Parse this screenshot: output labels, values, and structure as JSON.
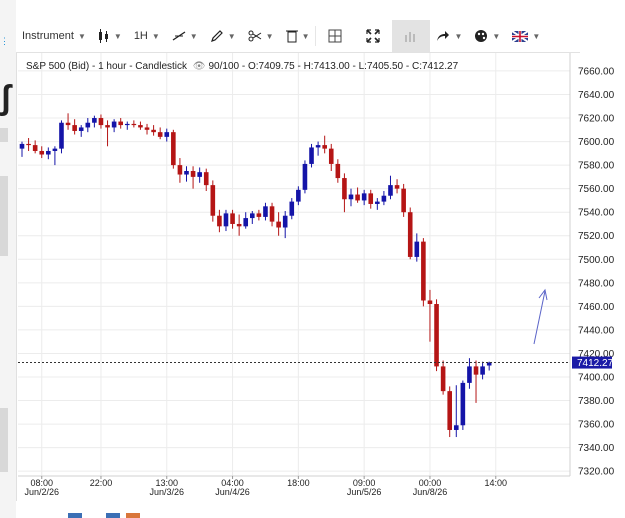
{
  "toolbar": {
    "instrument_label": "Instrument",
    "timeframe_label": "1H",
    "buttons": [
      "candlestick-icon",
      "line-tool-icon",
      "pencil-icon",
      "scissors-icon",
      "trash-icon",
      "crosshair-icon",
      "expand-icon",
      "indicator-icon",
      "share-icon",
      "palette-icon",
      "language-flag-icon"
    ]
  },
  "header": {
    "symbol": "S&P 500 (Bid) - 1 hour - Candlestick",
    "visibility": "90/100 -",
    "ohlc": "O:7409.75 - H:7413.00 - L:7405.50 - C:7412.27"
  },
  "colors": {
    "up": "#1414a8",
    "down": "#b51515",
    "price_line": "#333333",
    "price_tag_bg": "#1a1aa6",
    "annotation": "#5b64c8"
  },
  "chart_data": {
    "type": "candlestick",
    "title": "S&P 500 (Bid) - 1 hour - Candlestick",
    "current_price_label": "7412.27",
    "ylim": [
      7310,
      7670
    ],
    "y_ticks": [
      "7660.00",
      "7640.00",
      "7620.00",
      "7600.00",
      "7580.00",
      "7560.00",
      "7540.00",
      "7520.00",
      "7500.00",
      "7480.00",
      "7460.00",
      "7440.00",
      "7420.00",
      "7400.00",
      "7380.00",
      "7360.00",
      "7340.00",
      "7320.00"
    ],
    "time_ticks": [
      {
        "i": 3,
        "label": "08:00",
        "date": "Jun/2/26"
      },
      {
        "i": 12,
        "label": "22:00",
        "date": ""
      },
      {
        "i": 22,
        "label": "13:00",
        "date": "Jun/3/26"
      },
      {
        "i": 32,
        "label": "04:00",
        "date": "Jun/4/26"
      },
      {
        "i": 42,
        "label": "18:00",
        "date": ""
      },
      {
        "i": 52,
        "label": "09:00",
        "date": "Jun/5/26"
      },
      {
        "i": 62,
        "label": "00:00",
        "date": "Jun/8/26"
      },
      {
        "i": 72,
        "label": "14:00",
        "date": ""
      }
    ],
    "candles": [
      {
        "o": 7594,
        "h": 7600,
        "l": 7587,
        "c": 7598
      },
      {
        "o": 7598,
        "h": 7603,
        "l": 7592,
        "c": 7597
      },
      {
        "o": 7597,
        "h": 7601,
        "l": 7590,
        "c": 7592
      },
      {
        "o": 7592,
        "h": 7596,
        "l": 7586,
        "c": 7589
      },
      {
        "o": 7589,
        "h": 7595,
        "l": 7585,
        "c": 7592
      },
      {
        "o": 7592,
        "h": 7596,
        "l": 7580,
        "c": 7594
      },
      {
        "o": 7594,
        "h": 7618,
        "l": 7590,
        "c": 7616
      },
      {
        "o": 7616,
        "h": 7624,
        "l": 7610,
        "c": 7614
      },
      {
        "o": 7614,
        "h": 7619,
        "l": 7606,
        "c": 7609
      },
      {
        "o": 7609,
        "h": 7614,
        "l": 7604,
        "c": 7612
      },
      {
        "o": 7612,
        "h": 7620,
        "l": 7608,
        "c": 7616
      },
      {
        "o": 7616,
        "h": 7622,
        "l": 7612,
        "c": 7620
      },
      {
        "o": 7620,
        "h": 7623,
        "l": 7611,
        "c": 7614
      },
      {
        "o": 7614,
        "h": 7618,
        "l": 7596,
        "c": 7612
      },
      {
        "o": 7612,
        "h": 7619,
        "l": 7608,
        "c": 7617
      },
      {
        "o": 7617,
        "h": 7620,
        "l": 7611,
        "c": 7614
      },
      {
        "o": 7614,
        "h": 7617,
        "l": 7610,
        "c": 7615
      },
      {
        "o": 7615,
        "h": 7618,
        "l": 7612,
        "c": 7614
      },
      {
        "o": 7614,
        "h": 7617,
        "l": 7610,
        "c": 7612
      },
      {
        "o": 7612,
        "h": 7615,
        "l": 7606,
        "c": 7610
      },
      {
        "o": 7610,
        "h": 7614,
        "l": 7605,
        "c": 7608
      },
      {
        "o": 7608,
        "h": 7612,
        "l": 7602,
        "c": 7604
      },
      {
        "o": 7604,
        "h": 7611,
        "l": 7600,
        "c": 7608
      },
      {
        "o": 7608,
        "h": 7610,
        "l": 7577,
        "c": 7580
      },
      {
        "o": 7580,
        "h": 7586,
        "l": 7565,
        "c": 7572
      },
      {
        "o": 7572,
        "h": 7579,
        "l": 7566,
        "c": 7575
      },
      {
        "o": 7575,
        "h": 7579,
        "l": 7560,
        "c": 7570
      },
      {
        "o": 7570,
        "h": 7578,
        "l": 7565,
        "c": 7574
      },
      {
        "o": 7574,
        "h": 7577,
        "l": 7558,
        "c": 7563
      },
      {
        "o": 7563,
        "h": 7567,
        "l": 7532,
        "c": 7537
      },
      {
        "o": 7537,
        "h": 7542,
        "l": 7523,
        "c": 7528
      },
      {
        "o": 7528,
        "h": 7542,
        "l": 7524,
        "c": 7539
      },
      {
        "o": 7539,
        "h": 7542,
        "l": 7526,
        "c": 7530
      },
      {
        "o": 7530,
        "h": 7538,
        "l": 7520,
        "c": 7528
      },
      {
        "o": 7528,
        "h": 7540,
        "l": 7526,
        "c": 7535
      },
      {
        "o": 7535,
        "h": 7541,
        "l": 7530,
        "c": 7539
      },
      {
        "o": 7539,
        "h": 7542,
        "l": 7533,
        "c": 7536
      },
      {
        "o": 7536,
        "h": 7548,
        "l": 7533,
        "c": 7545
      },
      {
        "o": 7545,
        "h": 7548,
        "l": 7528,
        "c": 7532
      },
      {
        "o": 7532,
        "h": 7540,
        "l": 7520,
        "c": 7527
      },
      {
        "o": 7527,
        "h": 7541,
        "l": 7518,
        "c": 7537
      },
      {
        "o": 7537,
        "h": 7552,
        "l": 7534,
        "c": 7549
      },
      {
        "o": 7549,
        "h": 7562,
        "l": 7546,
        "c": 7559
      },
      {
        "o": 7559,
        "h": 7584,
        "l": 7556,
        "c": 7581
      },
      {
        "o": 7581,
        "h": 7598,
        "l": 7578,
        "c": 7595
      },
      {
        "o": 7595,
        "h": 7600,
        "l": 7588,
        "c": 7597
      },
      {
        "o": 7597,
        "h": 7605,
        "l": 7590,
        "c": 7594
      },
      {
        "o": 7594,
        "h": 7598,
        "l": 7575,
        "c": 7581
      },
      {
        "o": 7581,
        "h": 7585,
        "l": 7565,
        "c": 7569
      },
      {
        "o": 7569,
        "h": 7573,
        "l": 7540,
        "c": 7551
      },
      {
        "o": 7551,
        "h": 7560,
        "l": 7545,
        "c": 7555
      },
      {
        "o": 7555,
        "h": 7561,
        "l": 7548,
        "c": 7550
      },
      {
        "o": 7550,
        "h": 7559,
        "l": 7546,
        "c": 7556
      },
      {
        "o": 7556,
        "h": 7559,
        "l": 7543,
        "c": 7547
      },
      {
        "o": 7547,
        "h": 7552,
        "l": 7542,
        "c": 7549
      },
      {
        "o": 7549,
        "h": 7558,
        "l": 7546,
        "c": 7554
      },
      {
        "o": 7554,
        "h": 7571,
        "l": 7551,
        "c": 7563
      },
      {
        "o": 7563,
        "h": 7568,
        "l": 7556,
        "c": 7560
      },
      {
        "o": 7560,
        "h": 7564,
        "l": 7536,
        "c": 7540
      },
      {
        "o": 7540,
        "h": 7544,
        "l": 7500,
        "c": 7502
      },
      {
        "o": 7502,
        "h": 7522,
        "l": 7498,
        "c": 7515
      },
      {
        "o": 7515,
        "h": 7518,
        "l": 7460,
        "c": 7465
      },
      {
        "o": 7465,
        "h": 7474,
        "l": 7430,
        "c": 7462
      },
      {
        "o": 7462,
        "h": 7466,
        "l": 7405,
        "c": 7409
      },
      {
        "o": 7409,
        "h": 7414,
        "l": 7385,
        "c": 7388
      },
      {
        "o": 7388,
        "h": 7392,
        "l": 7349,
        "c": 7355
      },
      {
        "o": 7355,
        "h": 7393,
        "l": 7349,
        "c": 7359
      },
      {
        "o": 7359,
        "h": 7397,
        "l": 7355,
        "c": 7395
      },
      {
        "o": 7395,
        "h": 7416,
        "l": 7390,
        "c": 7409
      },
      {
        "o": 7409,
        "h": 7414,
        "l": 7378,
        "c": 7402
      },
      {
        "o": 7402,
        "h": 7413,
        "l": 7398,
        "c": 7409
      },
      {
        "o": 7409.75,
        "h": 7413,
        "l": 7405.5,
        "c": 7412.27
      }
    ]
  }
}
